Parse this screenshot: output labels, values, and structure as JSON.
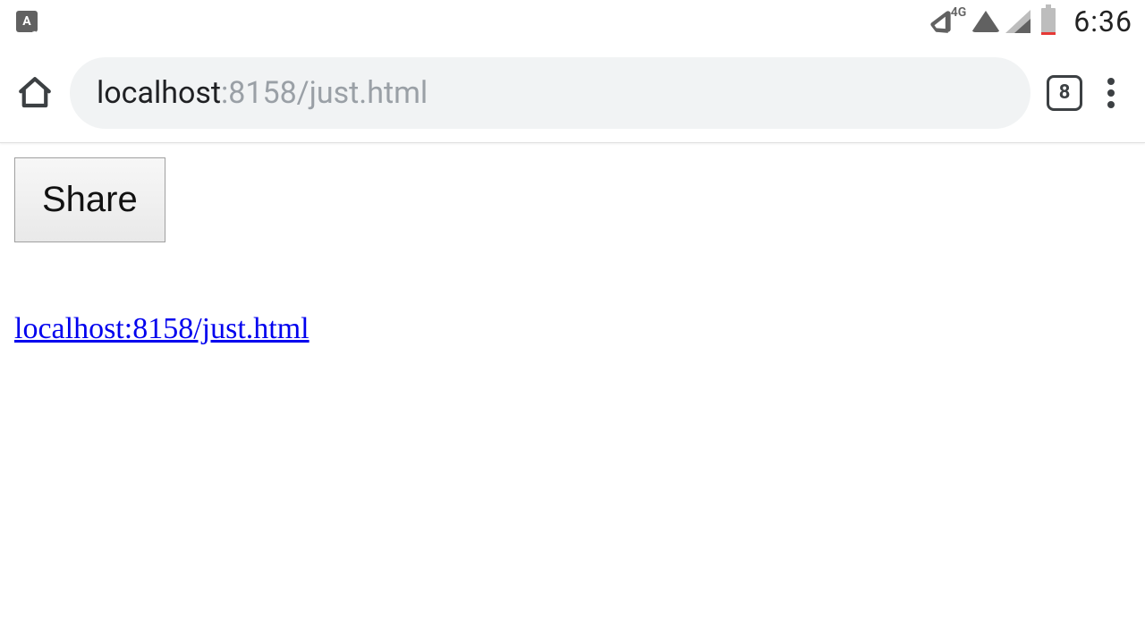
{
  "statusbar": {
    "ime_letter": "A",
    "network_label": "4G",
    "clock": "6:36"
  },
  "browser": {
    "url_host": "localhost",
    "url_rest": ":8158/just.html",
    "tab_count": "8"
  },
  "page": {
    "share_button_label": "Share",
    "link_text": "localhost:8158/just.html"
  }
}
